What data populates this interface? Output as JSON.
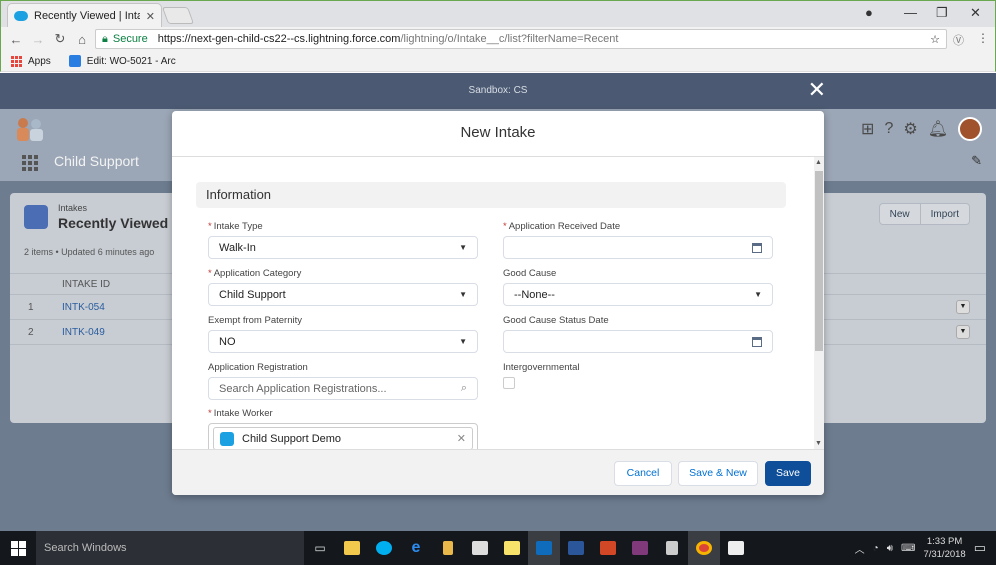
{
  "browser": {
    "tab_title": "Recently Viewed | Intake",
    "secure_label": "Secure",
    "url_host": "https://next-gen-child-cs22--cs.lightning.force.com",
    "url_path": "/lightning/o/Intake__c/list?filterName=Recent",
    "bookmarks": [
      {
        "label": "Apps"
      },
      {
        "label": "Edit: WO-5021 - Arc"
      }
    ]
  },
  "salesforce": {
    "sandbox_label": "Sandbox: CS",
    "app_name": "Child Support",
    "list": {
      "object_label": "Intakes",
      "title": "Recently Viewed",
      "meta": "2 items • Updated 6 minutes ago",
      "new_label": "New",
      "import_label": "Import",
      "column_header": "INTAKE ID",
      "rows": [
        {
          "num": "1",
          "id": "INTK-054"
        },
        {
          "num": "2",
          "id": "INTK-049"
        }
      ]
    }
  },
  "modal": {
    "title": "New Intake",
    "section": "Information",
    "fields": {
      "intake_type": {
        "label": "Intake Type",
        "value": "Walk-In"
      },
      "application_category": {
        "label": "Application Category",
        "value": "Child Support"
      },
      "exempt_paternity": {
        "label": "Exempt from Paternity",
        "value": "NO"
      },
      "application_registration": {
        "label": "Application Registration",
        "placeholder": "Search Application Registrations..."
      },
      "intake_worker": {
        "label": "Intake Worker",
        "value": "Child Support Demo"
      },
      "received_date": {
        "label": "Application Received Date",
        "value": ""
      },
      "good_cause": {
        "label": "Good Cause",
        "value": "--None--"
      },
      "good_cause_status_date": {
        "label": "Good Cause Status Date",
        "value": ""
      },
      "intergovernmental": {
        "label": "Intergovernmental"
      }
    },
    "buttons": {
      "cancel": "Cancel",
      "save_new": "Save & New",
      "save": "Save"
    }
  },
  "taskbar": {
    "search_placeholder": "Search Windows",
    "time": "1:33 PM",
    "date": "7/31/2018"
  }
}
